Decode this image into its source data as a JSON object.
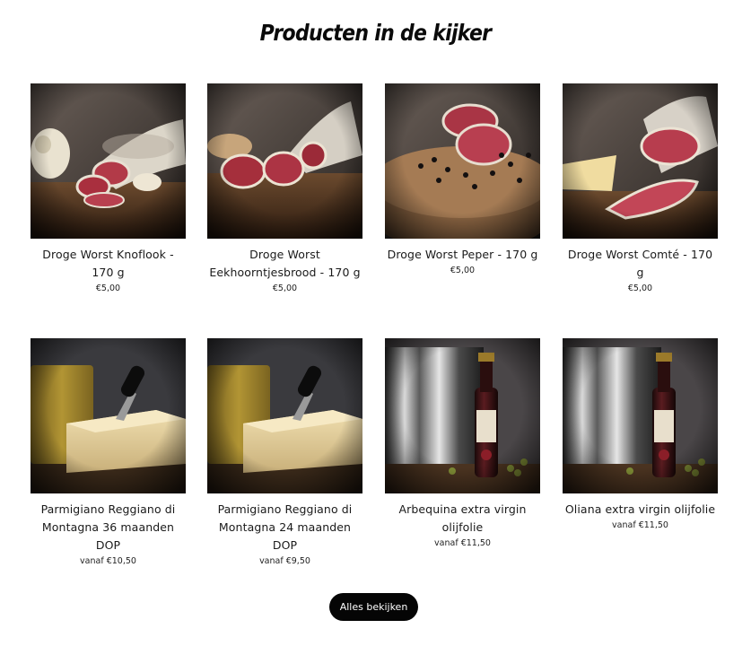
{
  "section": {
    "title": "Producten in de kijker"
  },
  "products": [
    {
      "name": "Droge Worst Knoflook - 170 g",
      "price": "€5,00",
      "image": "salami-garlic-image"
    },
    {
      "name": "Droge Worst Eekhoorntjesbrood - 170 g",
      "price": "€5,00",
      "image": "salami-mushroom-image"
    },
    {
      "name": "Droge Worst Peper - 170 g",
      "price": "€5,00",
      "image": "salami-pepper-image"
    },
    {
      "name": "Droge Worst Comté - 170 g",
      "price": "€5,00",
      "image": "salami-comte-image"
    },
    {
      "name": "Parmigiano Reggiano di Montagna 36 maanden DOP",
      "price": "vanaf €10,50",
      "image": "parmesan-knife-image"
    },
    {
      "name": "Parmigiano Reggiano di Montagna 24 maanden DOP",
      "price": "vanaf €9,50",
      "image": "parmesan-knife-image"
    },
    {
      "name": "Arbequina extra virgin olijfolie",
      "price": "vanaf €11,50",
      "image": "olive-oil-bottle-image"
    },
    {
      "name": "Oliana extra virgin olijfolie",
      "price": "vanaf €11,50",
      "image": "olive-oil-bottle-image"
    }
  ],
  "actions": {
    "view_all_label": "Alles bekijken"
  }
}
